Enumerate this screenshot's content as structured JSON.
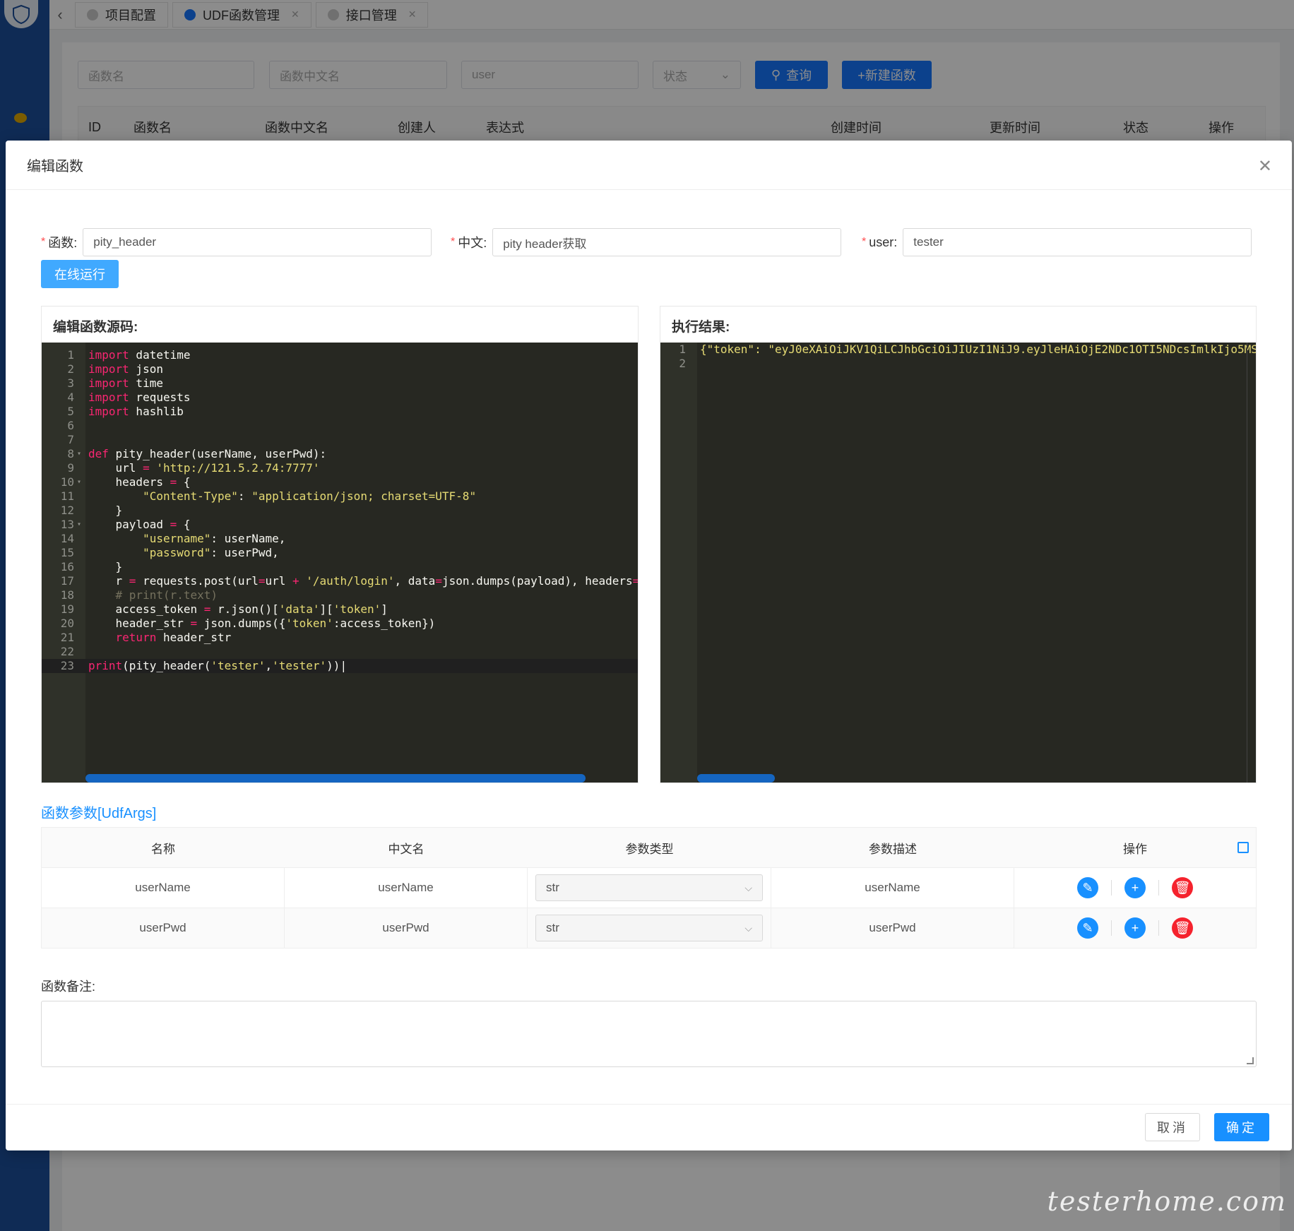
{
  "tabs": [
    {
      "label": "项目配置"
    },
    {
      "label": "UDF函数管理"
    },
    {
      "label": "接口管理"
    }
  ],
  "background": {
    "filters": {
      "func_name": "函数名",
      "func_cn": "函数中文名",
      "user": "user",
      "status": "状态"
    },
    "query_label": "查询",
    "new_label": "+新建函数",
    "columns": [
      "ID",
      "函数名",
      "函数中文名",
      "创建人",
      "表达式",
      "创建时间",
      "更新时间",
      "状态",
      "操作"
    ]
  },
  "modal": {
    "title": "编辑函数",
    "form": {
      "func_label": "函数:",
      "func_value": "pity_header",
      "cn_label": "中文:",
      "cn_value": "pity header获取",
      "user_label": "user:",
      "user_value": "tester"
    },
    "run_label": "在线运行",
    "source_title": "编辑函数源码:",
    "result_title": "执行结果:",
    "result_lines": [
      "{\"token\": \"eyJ0eXAiOiJKV1QiLCJhbGciOiJIUzI1NiJ9.eyJleHAiOjE2NDc1OTI5NDcsImlkIjo5MS",
      ""
    ],
    "args_title": "函数参数[UdfArgs]",
    "args_columns": [
      "名称",
      "中文名",
      "参数类型",
      "参数描述",
      "操作"
    ],
    "args_rows": [
      {
        "name": "userName",
        "cn": "userName",
        "type": "str",
        "desc": "userName"
      },
      {
        "name": "userPwd",
        "cn": "userPwd",
        "type": "str",
        "desc": "userPwd"
      }
    ],
    "remark_label": "函数备注:",
    "cancel_label": "取消",
    "ok_label": "确定"
  },
  "watermark": "testerhome.com",
  "colors": {
    "primary": "#1890ff",
    "danger": "#f5222d",
    "editor_bg": "#272822",
    "keyword": "#f92672",
    "string": "#e6db74"
  }
}
